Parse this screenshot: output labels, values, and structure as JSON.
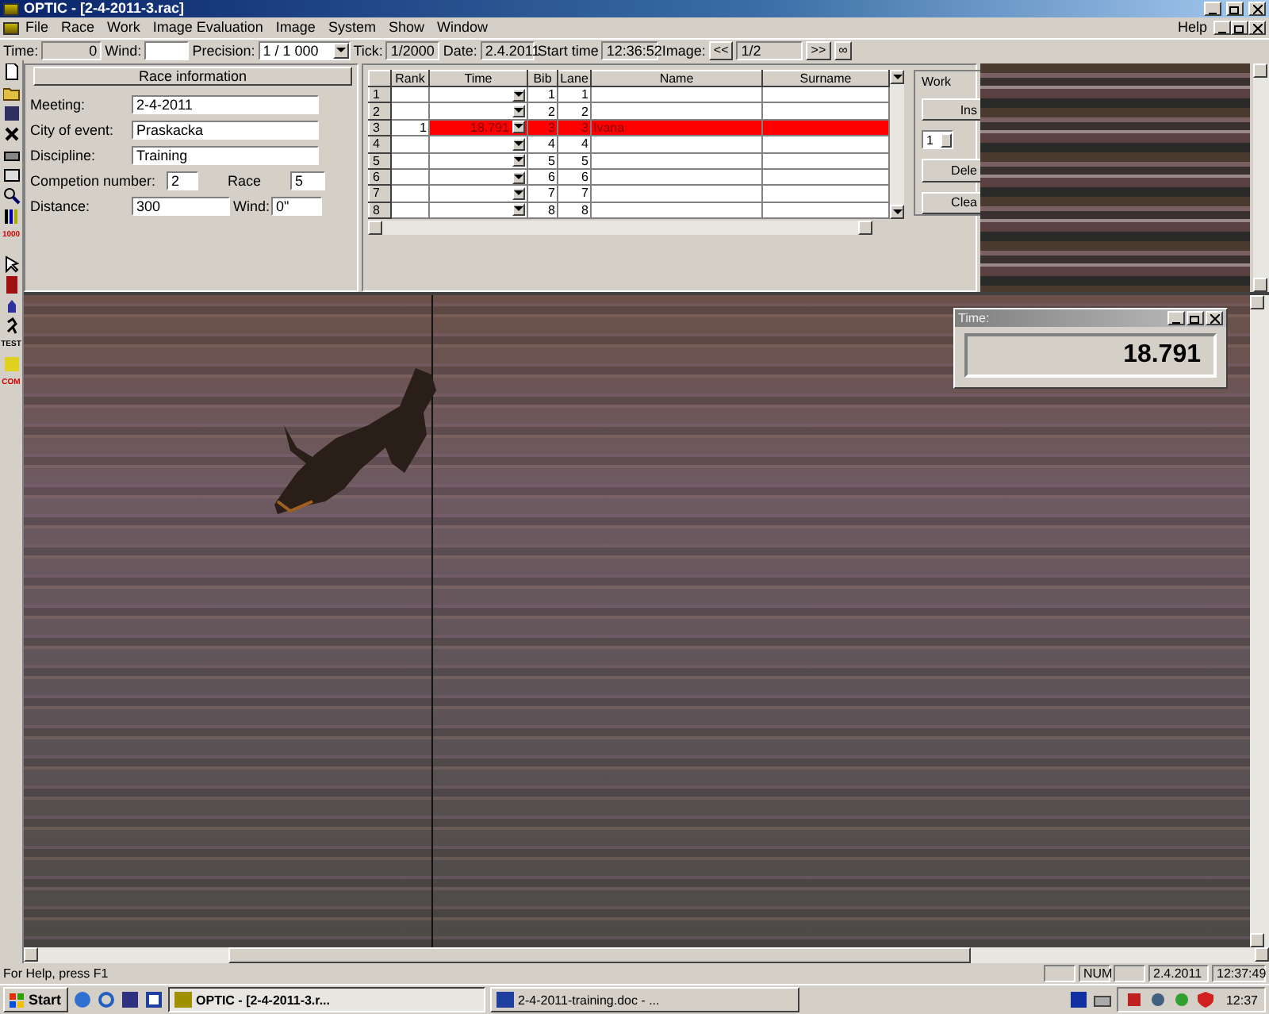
{
  "window": {
    "title": "OPTIC - [2-4-2011-3.rac]"
  },
  "menu": {
    "items": [
      "File",
      "Race",
      "Work",
      "Image Evaluation",
      "Image",
      "System",
      "Show",
      "Window"
    ],
    "help": "Help"
  },
  "toolbar": {
    "time_label": "Time:",
    "time_value": "0",
    "wind_label": "Wind:",
    "precision_label": "Precision:",
    "precision_value": "1 / 1 000",
    "tick_label": "Tick:",
    "tick_value": "1/2000",
    "date_label": "Date:",
    "date_value": "2.4.2011",
    "start_label": "Start time",
    "start_value": "12:36:52",
    "image_label": "Image:",
    "prev": "<<",
    "image_value": "1/2",
    "next": ">>",
    "loop": "∞"
  },
  "left_toolbar_labels": [
    "1000",
    "TEST",
    "COM"
  ],
  "race_info": {
    "title": "Race information",
    "meeting_label": "Meeting:",
    "meeting": "2-4-2011",
    "city_label": "City of event:",
    "city": "Praskacka",
    "discipline_label": "Discipline:",
    "discipline": "Training",
    "competition_label": "Competion number:",
    "competition": "2",
    "race_label": "Race",
    "race": "5",
    "distance_label": "Distance:",
    "distance": "300",
    "wind_label": "Wind:",
    "wind": "0\""
  },
  "table": {
    "columns": [
      "Rank",
      "Time",
      "Bib",
      "Lane",
      "Name",
      "Surname"
    ],
    "rows": [
      {
        "row": "1",
        "bib": "1",
        "lane": "1",
        "selected": false
      },
      {
        "row": "2",
        "bib": "2",
        "lane": "2",
        "selected": false
      },
      {
        "row": "3",
        "rank": "1",
        "time": "18.791",
        "bib": "3",
        "lane": "3",
        "name": "Ivana",
        "selected": true
      },
      {
        "row": "4",
        "bib": "4",
        "lane": "4",
        "selected": false
      },
      {
        "row": "5",
        "bib": "5",
        "lane": "5",
        "selected": false
      },
      {
        "row": "6",
        "bib": "6",
        "lane": "6",
        "selected": false
      },
      {
        "row": "7",
        "bib": "7",
        "lane": "7",
        "selected": false
      },
      {
        "row": "8",
        "bib": "8",
        "lane": "8",
        "selected": false
      }
    ]
  },
  "work": {
    "title": "Work",
    "insert": "Ins",
    "spinner": "1",
    "delete": "Dele",
    "clear": "Clea"
  },
  "time_window": {
    "title": "Time:",
    "value": "18.791"
  },
  "status_bar": {
    "text": "For Help, press F1",
    "num": "NUM",
    "date": "2.4.2011",
    "time": "12:37:49"
  },
  "taskbar": {
    "start": "Start",
    "tasks": [
      {
        "label": "OPTIC - [2-4-2011-3.r...",
        "selected": true
      },
      {
        "label": "2-4-2011-training.doc - ...",
        "selected": false
      }
    ],
    "clock": "12:37"
  }
}
